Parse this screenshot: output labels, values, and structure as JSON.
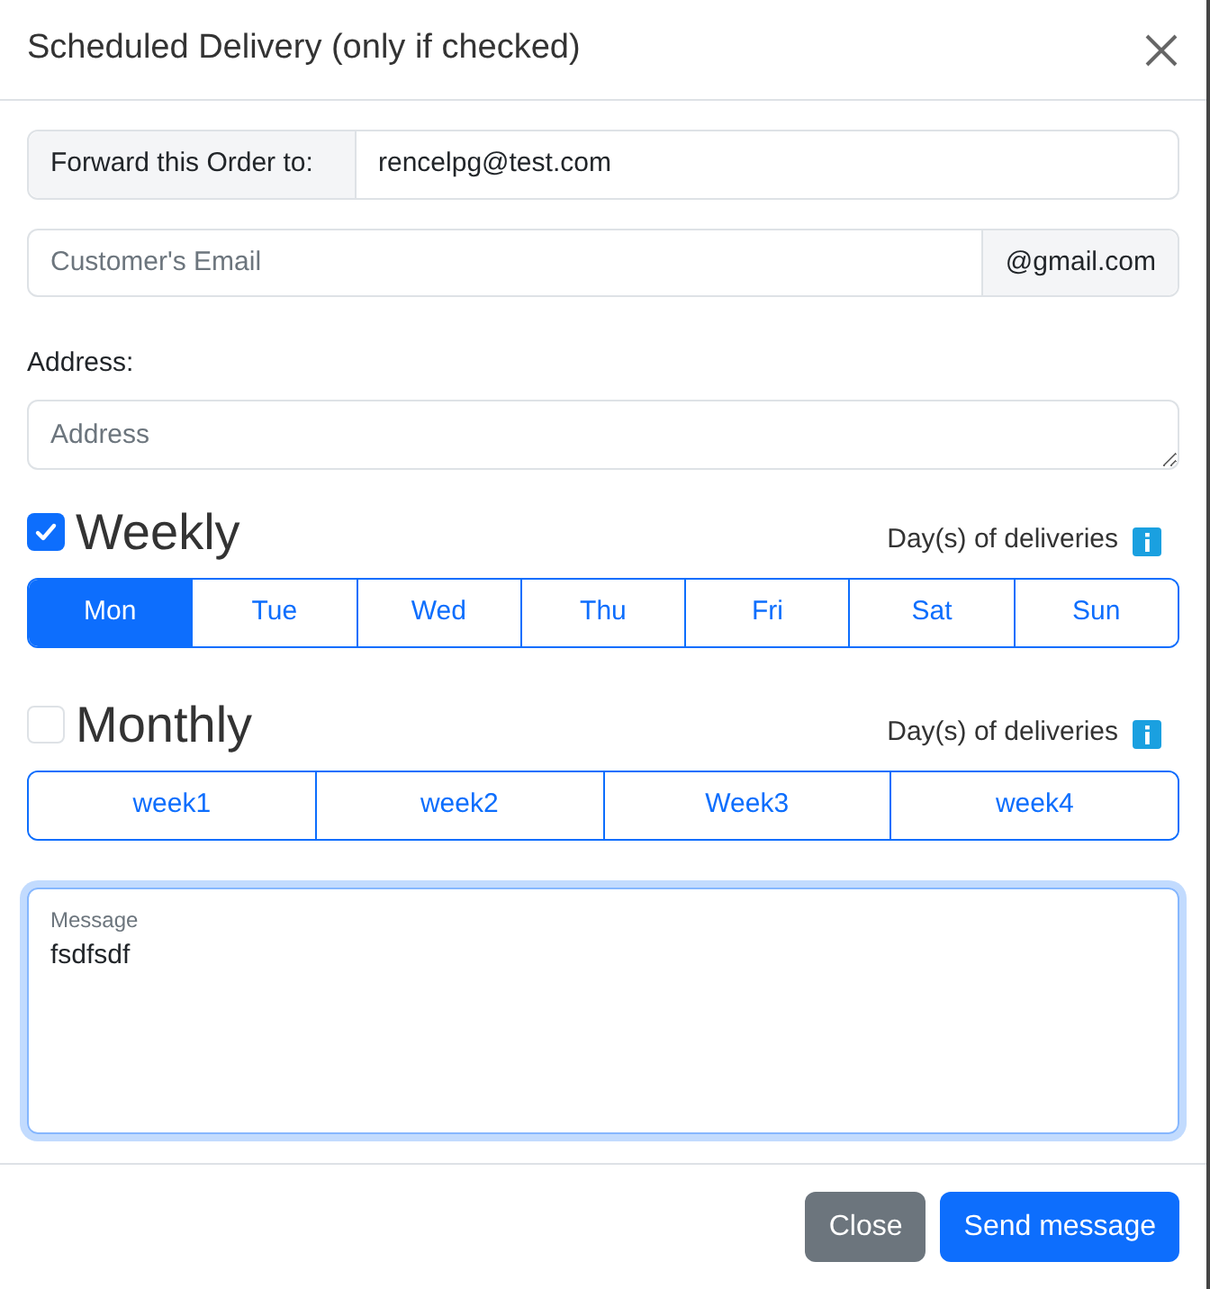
{
  "modal": {
    "title": "Scheduled Delivery (only if checked)"
  },
  "forward": {
    "label": "Forward this Order to:",
    "value": "rencelpg@test.com"
  },
  "customer_email": {
    "placeholder": "Customer's Email",
    "suffix": "@gmail.com"
  },
  "address": {
    "label": "Address:",
    "placeholder": "Address"
  },
  "schedules": [
    {
      "label": "Weekly",
      "checked": true,
      "hint": "Day(s) of deliveries",
      "options": [
        {
          "label": "Mon",
          "selected": true
        },
        {
          "label": "Tue",
          "selected": false
        },
        {
          "label": "Wed",
          "selected": false
        },
        {
          "label": "Thu",
          "selected": false
        },
        {
          "label": "Fri",
          "selected": false
        },
        {
          "label": "Sat",
          "selected": false
        },
        {
          "label": "Sun",
          "selected": false
        }
      ]
    },
    {
      "label": "Monthly",
      "checked": false,
      "hint": "Day(s) of deliveries",
      "options": [
        {
          "label": "week1",
          "selected": false
        },
        {
          "label": "week2",
          "selected": false
        },
        {
          "label": "Week3",
          "selected": false
        },
        {
          "label": "week4",
          "selected": false
        }
      ]
    }
  ],
  "message": {
    "label": "Message",
    "value": "fsdfsdf"
  },
  "buttons": [
    {
      "label": "Close",
      "kind": "secondary"
    },
    {
      "label": "Send message",
      "kind": "primary"
    }
  ]
}
